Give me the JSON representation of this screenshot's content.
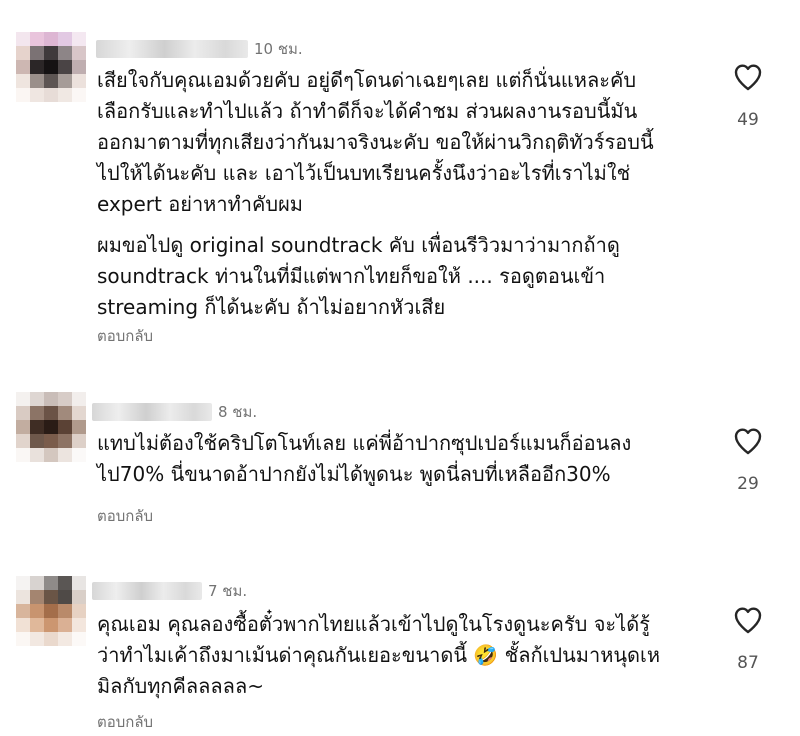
{
  "comments": [
    {
      "time": "10 ชม.",
      "paragraphs": [
        [
          "เสียใจกับคุณเอมด้วยคับ อยู่ดีๆโดนด่าเฉยๆเลย แต่ก็นั่นแหละคับ",
          "เลือกรับและทำไปแล้ว ถ้าทำดีก็จะได้คำชม ส่วนผลงานรอบนี้มัน",
          "ออกมาตามที่ทุกเสียงว่ากันมาจริงนะคับ  ขอให้ผ่านวิกฤติทัวร์รอบนี้",
          "ไปให้ได้นะคับ และ เอาไว้เป็นบทเรียนครั้งนึงว่าอะไรที่เราไม่ใช่",
          "expert อย่าหาทำคับผม"
        ],
        [
          "ผมขอไปดู original soundtrack คับ เพื่อนรีวิวมาว่ามากถ้าดู",
          "soundtrack  ท่านในที่มีแต่พากไทยก็ขอให้ .... รอดูตอนเข้า",
          "streaming ก็ได้นะคับ ถ้าไม่อยากหัวเสีย"
        ]
      ],
      "reply_label": "ตอบกลับ",
      "likes": "49",
      "avatar_colors": [
        "#f3e6ee",
        "#e9c4dc",
        "#ddb6d3",
        "#e2c9e3",
        "#f4e8f1",
        "#e6d3cc",
        "#7b7274",
        "#3f3a3c",
        "#8d8587",
        "#d8c6c8",
        "#cdb7b2",
        "#2b2627",
        "#151213",
        "#4a4445",
        "#bfaeb0",
        "#efe5df",
        "#9a8f8a",
        "#5d5553",
        "#a69c98",
        "#ece1dc",
        "#fbf6f3",
        "#efe6e1",
        "#e7dcd7",
        "#f0e8e3",
        "#fbf7f5"
      ]
    },
    {
      "time": "8 ชม.",
      "paragraphs": [
        [
          "แทบไม่ต้องใช้คริปโตโนท์เลย แค่พี่อ้าปากซุปเปอร์แมนก็อ่อนลง",
          "ไป70% นี่ขนาดอ้าปากยังไม่ได้พูดนะ พูดนี่ลบที่เหลืออีก30%"
        ]
      ],
      "reply_label": "ตอบกลับ",
      "likes": "29",
      "avatar_colors": [
        "#f4f1ef",
        "#ded6d2",
        "#c9bdb8",
        "#d7ccc7",
        "#f2eeec",
        "#d9cbc3",
        "#8c7466",
        "#6b5346",
        "#a18a7c",
        "#e3d7d0",
        "#c2ada0",
        "#3f2d24",
        "#2a1c16",
        "#5b4235",
        "#b09a8c",
        "#e1d4cc",
        "#6e584b",
        "#7a5c4b",
        "#8d7364",
        "#ddd0c8",
        "#faf7f5",
        "#e9e1dc",
        "#d4c7bf",
        "#ece4df",
        "#fbf9f8"
      ]
    },
    {
      "time": "7 ชม.",
      "paragraphs": [
        [
          "คุณเอม คุณลองซื้อตั๋วพากไทยแล้วเข้าไปดูในโรงดูนะครับ จะได้รู้",
          "ว่าทำไมเค้าถึงมาเม้นด่าคุณกันเยอะขนาดนี้ 🤣 ชั้ลก้เปนมาหนุดเห",
          "มิลกับทุกคีลลลลล~"
        ]
      ],
      "reply_label": "ตอบกลับ",
      "likes": "87",
      "avatar_colors": [
        "#f5f3f2",
        "#d8d3d0",
        "#8f8b89",
        "#5a5654",
        "#e8e5e3",
        "#ece4de",
        "#a48570",
        "#6a5546",
        "#4f4a47",
        "#d9cfc8",
        "#d8b59c",
        "#c8946f",
        "#a46e4a",
        "#b98a6a",
        "#e7d2c3",
        "#f1e1d5",
        "#e0b89a",
        "#cc9670",
        "#dab094",
        "#f3e6dd",
        "#fbf7f4",
        "#f2e8e1",
        "#ead9cd",
        "#f3e9e2",
        "#fcf9f7"
      ]
    }
  ],
  "icons": {
    "like": "heart-outline-icon"
  },
  "colors": {
    "meta_text": "#737373",
    "body_text": "#121212",
    "heart_stroke": "#262626"
  }
}
